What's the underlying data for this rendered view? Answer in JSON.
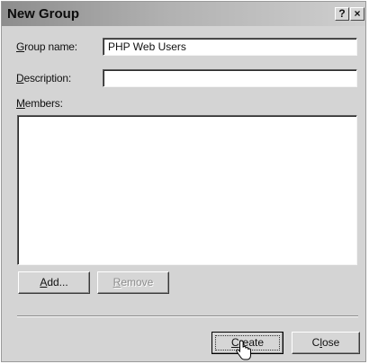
{
  "dialog": {
    "title": "New Group",
    "help_button": "?",
    "close_button": "×"
  },
  "form": {
    "group_name_label_key": "G",
    "group_name_label_rest": "roup name:",
    "group_name_value": "PHP Web Users",
    "description_label_key": "D",
    "description_label_rest": "escription:",
    "description_value": "",
    "members_label_key": "M",
    "members_label_rest": "embers:"
  },
  "buttons": {
    "add_key": "A",
    "add_rest": "dd...",
    "remove_key": "R",
    "remove_rest": "emove",
    "create_key": "C",
    "create_rest": "reate",
    "close_pre": "C",
    "close_key": "l",
    "close_rest": "ose"
  },
  "icons": {
    "cursor": "hand-pointer-icon"
  }
}
